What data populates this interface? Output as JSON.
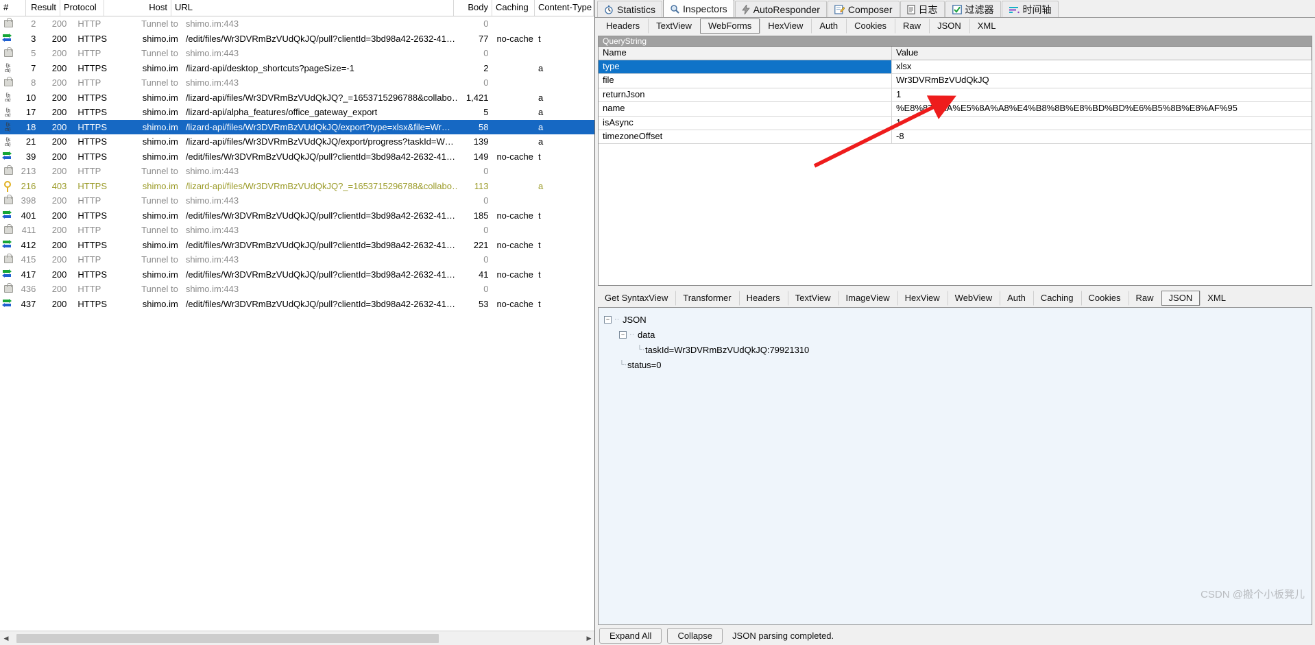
{
  "sessions": {
    "columns": [
      "#",
      "Result",
      "Protocol",
      "Host",
      "URL",
      "Body",
      "Caching",
      "Content-Type"
    ],
    "rows": [
      {
        "icon": "lock-icon",
        "num": "2",
        "result": "200",
        "protocol": "HTTP",
        "host": "Tunnel to",
        "url": "shimo.im:443",
        "body": "0",
        "caching": "",
        "ctype": "",
        "style": "tunnel"
      },
      {
        "icon": "arrows-icon",
        "num": "3",
        "result": "200",
        "protocol": "HTTPS",
        "host": "shimo.im",
        "url": "/edit/files/Wr3DVRmBzVUdQkJQ/pull?clientId=3bd98a42-2632-41…",
        "body": "77",
        "caching": "no-cache",
        "ctype": "t",
        "style": "normal"
      },
      {
        "icon": "lock-icon",
        "num": "5",
        "result": "200",
        "protocol": "HTTP",
        "host": "Tunnel to",
        "url": "shimo.im:443",
        "body": "0",
        "caching": "",
        "ctype": "",
        "style": "tunnel"
      },
      {
        "icon": "json-icon",
        "num": "7",
        "result": "200",
        "protocol": "HTTPS",
        "host": "shimo.im",
        "url": "/lizard-api/desktop_shortcuts?pageSize=-1",
        "body": "2",
        "caching": "",
        "ctype": "a",
        "style": "normal"
      },
      {
        "icon": "lock-icon",
        "num": "8",
        "result": "200",
        "protocol": "HTTP",
        "host": "Tunnel to",
        "url": "shimo.im:443",
        "body": "0",
        "caching": "",
        "ctype": "",
        "style": "tunnel"
      },
      {
        "icon": "json-icon",
        "num": "10",
        "result": "200",
        "protocol": "HTTPS",
        "host": "shimo.im",
        "url": "/lizard-api/files/Wr3DVRmBzVUdQkJQ?_=1653715296788&collabo…",
        "body": "1,421",
        "caching": "",
        "ctype": "a",
        "style": "normal"
      },
      {
        "icon": "json-icon",
        "num": "17",
        "result": "200",
        "protocol": "HTTPS",
        "host": "shimo.im",
        "url": "/lizard-api/alpha_features/office_gateway_export",
        "body": "5",
        "caching": "",
        "ctype": "a",
        "style": "normal"
      },
      {
        "icon": "json-icon",
        "num": "18",
        "result": "200",
        "protocol": "HTTPS",
        "host": "shimo.im",
        "url": "/lizard-api/files/Wr3DVRmBzVUdQkJQ/export?type=xlsx&file=Wr…",
        "body": "58",
        "caching": "",
        "ctype": "a",
        "style": "selected"
      },
      {
        "icon": "json-icon",
        "num": "21",
        "result": "200",
        "protocol": "HTTPS",
        "host": "shimo.im",
        "url": "/lizard-api/files/Wr3DVRmBzVUdQkJQ/export/progress?taskId=W…",
        "body": "139",
        "caching": "",
        "ctype": "a",
        "style": "normal"
      },
      {
        "icon": "arrows-icon",
        "num": "39",
        "result": "200",
        "protocol": "HTTPS",
        "host": "shimo.im",
        "url": "/edit/files/Wr3DVRmBzVUdQkJQ/pull?clientId=3bd98a42-2632-41…",
        "body": "149",
        "caching": "no-cache",
        "ctype": "t",
        "style": "normal"
      },
      {
        "icon": "lock-icon",
        "num": "213",
        "result": "200",
        "protocol": "HTTP",
        "host": "Tunnel to",
        "url": "shimo.im:443",
        "body": "0",
        "caching": "",
        "ctype": "",
        "style": "tunnel"
      },
      {
        "icon": "key-icon",
        "num": "216",
        "result": "403",
        "protocol": "HTTPS",
        "host": "shimo.im",
        "url": "/lizard-api/files/Wr3DVRmBzVUdQkJQ?_=1653715296788&collabo…",
        "body": "113",
        "caching": "",
        "ctype": "a",
        "style": "warn"
      },
      {
        "icon": "lock-icon",
        "num": "398",
        "result": "200",
        "protocol": "HTTP",
        "host": "Tunnel to",
        "url": "shimo.im:443",
        "body": "0",
        "caching": "",
        "ctype": "",
        "style": "tunnel"
      },
      {
        "icon": "arrows-icon",
        "num": "401",
        "result": "200",
        "protocol": "HTTPS",
        "host": "shimo.im",
        "url": "/edit/files/Wr3DVRmBzVUdQkJQ/pull?clientId=3bd98a42-2632-41…",
        "body": "185",
        "caching": "no-cache",
        "ctype": "t",
        "style": "normal"
      },
      {
        "icon": "lock-icon",
        "num": "411",
        "result": "200",
        "protocol": "HTTP",
        "host": "Tunnel to",
        "url": "shimo.im:443",
        "body": "0",
        "caching": "",
        "ctype": "",
        "style": "tunnel"
      },
      {
        "icon": "arrows-icon",
        "num": "412",
        "result": "200",
        "protocol": "HTTPS",
        "host": "shimo.im",
        "url": "/edit/files/Wr3DVRmBzVUdQkJQ/pull?clientId=3bd98a42-2632-41…",
        "body": "221",
        "caching": "no-cache",
        "ctype": "t",
        "style": "normal"
      },
      {
        "icon": "lock-icon",
        "num": "415",
        "result": "200",
        "protocol": "HTTP",
        "host": "Tunnel to",
        "url": "shimo.im:443",
        "body": "0",
        "caching": "",
        "ctype": "",
        "style": "tunnel"
      },
      {
        "icon": "arrows-icon",
        "num": "417",
        "result": "200",
        "protocol": "HTTPS",
        "host": "shimo.im",
        "url": "/edit/files/Wr3DVRmBzVUdQkJQ/pull?clientId=3bd98a42-2632-41…",
        "body": "41",
        "caching": "no-cache",
        "ctype": "t",
        "style": "normal"
      },
      {
        "icon": "lock-icon",
        "num": "436",
        "result": "200",
        "protocol": "HTTP",
        "host": "Tunnel to",
        "url": "shimo.im:443",
        "body": "0",
        "caching": "",
        "ctype": "",
        "style": "tunnel"
      },
      {
        "icon": "arrows-icon",
        "num": "437",
        "result": "200",
        "protocol": "HTTPS",
        "host": "shimo.im",
        "url": "/edit/files/Wr3DVRmBzVUdQkJQ/pull?clientId=3bd98a42-2632-41…",
        "body": "53",
        "caching": "no-cache",
        "ctype": "t",
        "style": "normal"
      }
    ]
  },
  "top_tabs": [
    {
      "label": "Statistics",
      "icon": "stopwatch-icon",
      "active": false
    },
    {
      "label": "Inspectors",
      "icon": "magnifier-icon",
      "active": true
    },
    {
      "label": "AutoResponder",
      "icon": "lightning-icon",
      "active": false
    },
    {
      "label": "Composer",
      "icon": "pencil-note-icon",
      "active": false
    },
    {
      "label": "日志",
      "icon": "log-icon",
      "active": false
    },
    {
      "label": "过滤器",
      "icon": "checkbox-checked-icon",
      "active": false
    },
    {
      "label": "时间轴",
      "icon": "timeline-icon",
      "active": false
    }
  ],
  "request_tabs": [
    {
      "label": "Headers",
      "active": false
    },
    {
      "label": "TextView",
      "active": false
    },
    {
      "label": "WebForms",
      "active": true
    },
    {
      "label": "HexView",
      "active": false
    },
    {
      "label": "Auth",
      "active": false
    },
    {
      "label": "Cookies",
      "active": false
    },
    {
      "label": "Raw",
      "active": false
    },
    {
      "label": "JSON",
      "active": false
    },
    {
      "label": "XML",
      "active": false
    }
  ],
  "querystring": {
    "section_title": "QueryString",
    "columns": [
      "Name",
      "Value"
    ],
    "rows": [
      {
        "name": "type",
        "value": "xlsx",
        "selected": true
      },
      {
        "name": "file",
        "value": "Wr3DVRmBzVUdQkJQ",
        "selected": false
      },
      {
        "name": "returnJson",
        "value": "1",
        "selected": false
      },
      {
        "name": "name",
        "value": "%E8%87%AA%E5%8A%A8%E4%B8%8B%E8%BD%BD%E6%B5%8B%E8%AF%95",
        "selected": false
      },
      {
        "name": "isAsync",
        "value": "1",
        "selected": false
      },
      {
        "name": "timezoneOffset",
        "value": "-8",
        "selected": false
      }
    ]
  },
  "response_tabs": [
    {
      "label": "Get SyntaxView",
      "active": false
    },
    {
      "label": "Transformer",
      "active": false
    },
    {
      "label": "Headers",
      "active": false
    },
    {
      "label": "TextView",
      "active": false
    },
    {
      "label": "ImageView",
      "active": false
    },
    {
      "label": "HexView",
      "active": false
    },
    {
      "label": "WebView",
      "active": false
    },
    {
      "label": "Auth",
      "active": false
    },
    {
      "label": "Caching",
      "active": false
    },
    {
      "label": "Cookies",
      "active": false
    },
    {
      "label": "Raw",
      "active": false
    },
    {
      "label": "JSON",
      "active": true
    },
    {
      "label": "XML",
      "active": false
    }
  ],
  "json_tree": {
    "root": "JSON",
    "data_node": "data",
    "task_node": "taskId=Wr3DVRmBzVUdQkJQ:79921310",
    "status_node": "status=0"
  },
  "bottom_bar": {
    "expand_all": "Expand All",
    "collapse": "Collapse",
    "status": "JSON parsing completed."
  },
  "watermark": "CSDN @搬个小板凳儿",
  "colors": {
    "selection_blue": "#1668c3",
    "header_gray": "#a0a0a0",
    "warn_yellow": "#9a9a26",
    "arrow_red": "#ee1c1c",
    "json_panel_bg": "#eff5fb"
  }
}
